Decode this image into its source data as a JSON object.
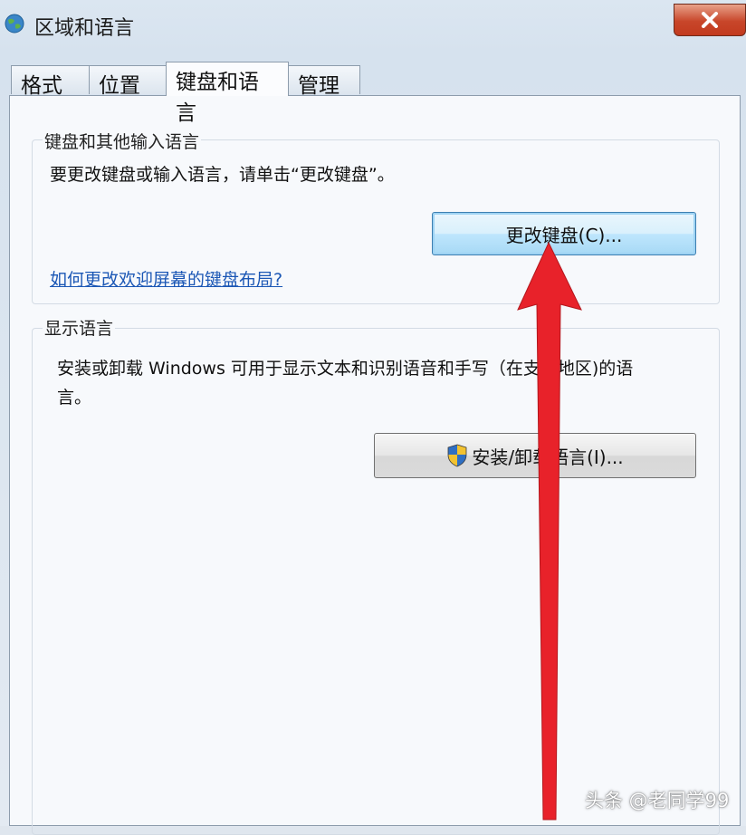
{
  "window": {
    "title": "区域和语言",
    "close_icon": "close-icon"
  },
  "tabs": [
    {
      "label": "格式"
    },
    {
      "label": "位置"
    },
    {
      "label": "键盘和语言",
      "active": true
    },
    {
      "label": "管理"
    }
  ],
  "keyboard_group": {
    "title": "键盘和其他输入语言",
    "description": "要更改键盘或输入语言，请单击“更改键盘”。",
    "change_button": "更改键盘(C)...",
    "link": "如何更改欢迎屏幕的键盘布局?"
  },
  "display_group": {
    "title": "显示语言",
    "description_line1": "安装或卸载 Windows 可用于显示文本和识别语音和手写（在支持地区)的语",
    "description_line2": "言。",
    "install_button": "安装/卸载语言(I)...",
    "install_button_icon": "uac-shield-icon"
  },
  "annotation": {
    "arrow_color": "#e8222a"
  },
  "watermark": "头条 @老同学99"
}
